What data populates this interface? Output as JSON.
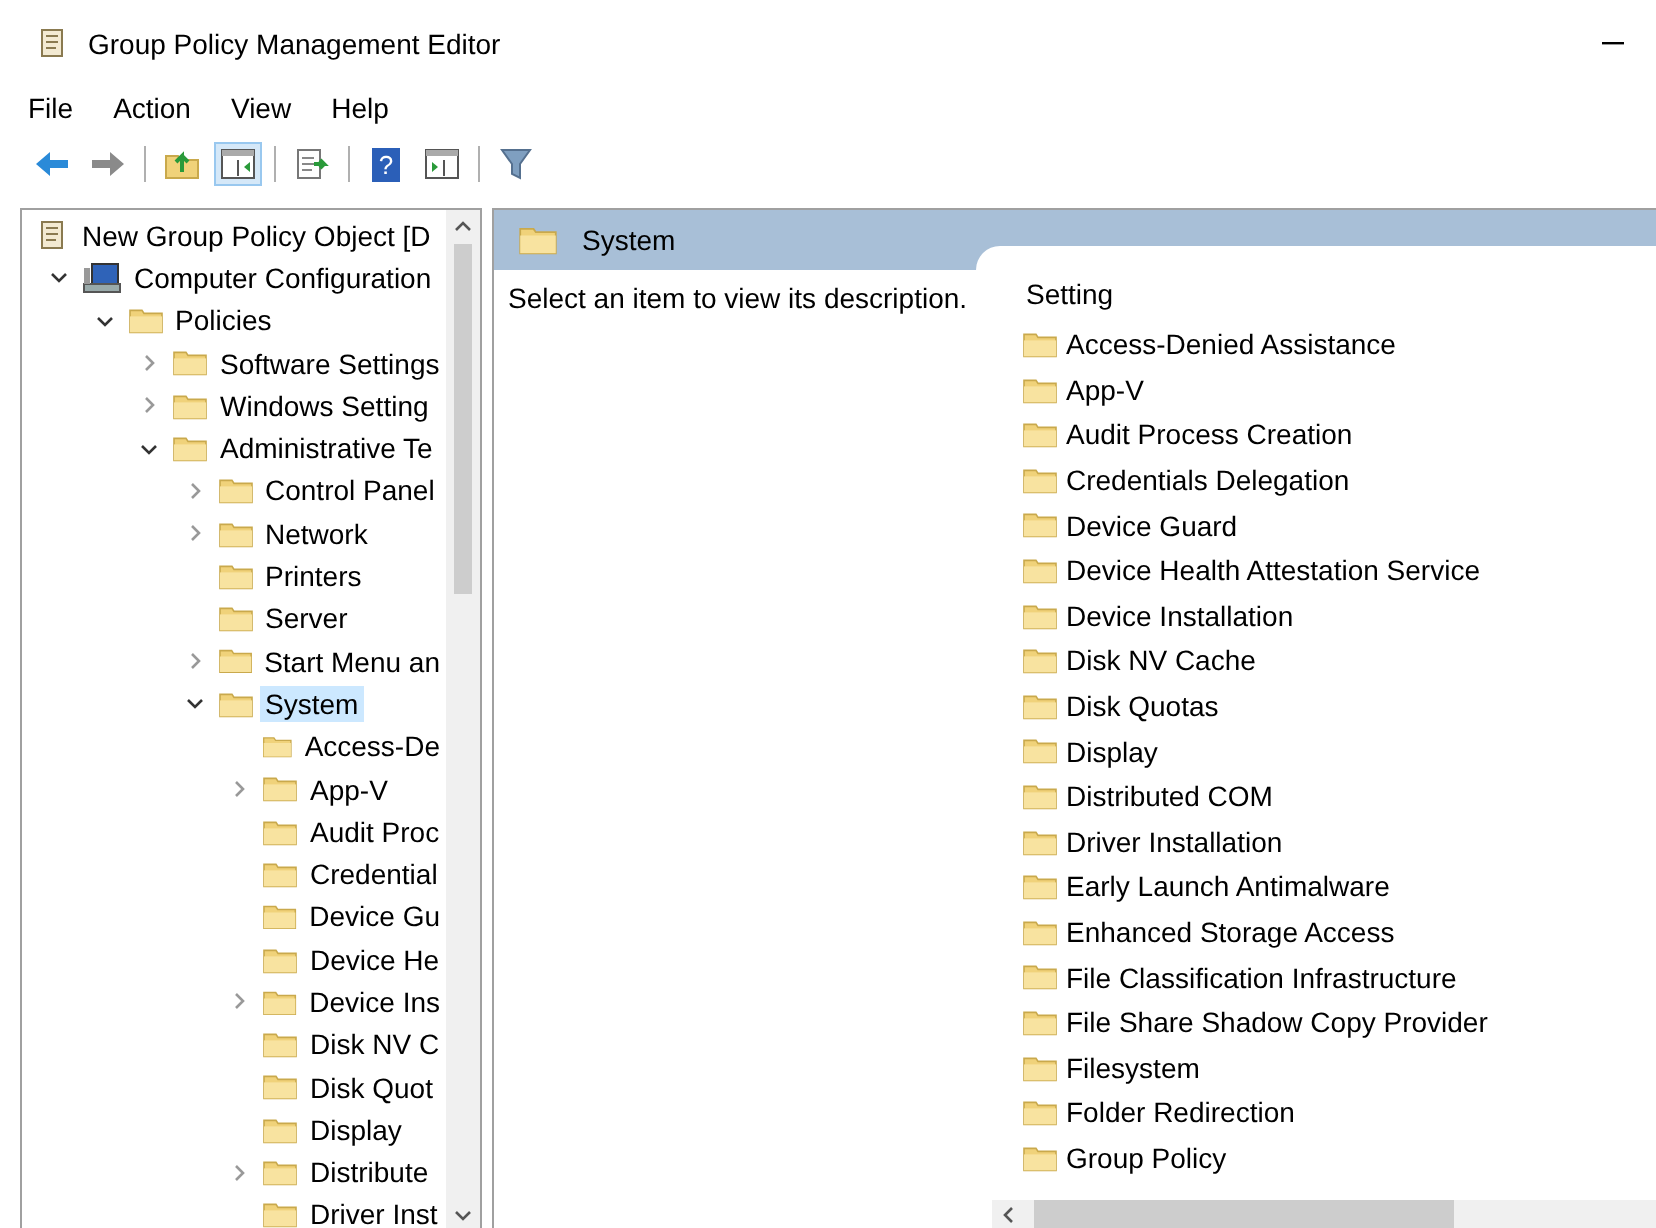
{
  "window": {
    "title": "Group Policy Management Editor"
  },
  "menu": [
    "File",
    "Action",
    "View",
    "Help"
  ],
  "toolbar": [
    [
      {
        "kind": "back",
        "pressed": false
      },
      {
        "kind": "forward",
        "pressed": false
      }
    ],
    [
      {
        "kind": "up",
        "pressed": false
      },
      {
        "kind": "tree",
        "pressed": true
      }
    ],
    [
      {
        "kind": "export",
        "pressed": false
      }
    ],
    [
      {
        "kind": "help",
        "pressed": false,
        "glyph": "?"
      },
      {
        "kind": "actions",
        "pressed": false
      }
    ],
    [
      {
        "kind": "filter",
        "pressed": false
      }
    ]
  ],
  "tree": [
    {
      "label": "New Group Policy Object [D",
      "kind": "scroll",
      "selected": false,
      "children": [
        {
          "label": "Computer Configuration",
          "kind": "computer",
          "expanded": true,
          "selected": false,
          "children": [
            {
              "label": "Policies",
              "kind": "folder",
              "expanded": true,
              "selected": false,
              "children": [
                {
                  "label": "Software Settings",
                  "kind": "folder",
                  "expanded": false,
                  "selected": false
                },
                {
                  "label": "Windows Setting",
                  "kind": "folder",
                  "expanded": false,
                  "selected": false
                },
                {
                  "label": "Administrative Te",
                  "kind": "folder",
                  "expanded": true,
                  "selected": false,
                  "children": [
                    {
                      "label": "Control Panel",
                      "kind": "folder",
                      "expanded": false,
                      "selected": false
                    },
                    {
                      "label": "Network",
                      "kind": "folder",
                      "expanded": false,
                      "selected": false
                    },
                    {
                      "label": "Printers",
                      "kind": "folder",
                      "selected": false
                    },
                    {
                      "label": "Server",
                      "kind": "folder",
                      "selected": false
                    },
                    {
                      "label": "Start Menu an",
                      "kind": "folder",
                      "expanded": false,
                      "selected": false
                    },
                    {
                      "label": "System",
                      "kind": "folder",
                      "expanded": true,
                      "selected": true,
                      "children": [
                        {
                          "label": "Access-De",
                          "kind": "folder",
                          "selected": false
                        },
                        {
                          "label": "App-V",
                          "kind": "folder",
                          "expanded": false,
                          "selected": false
                        },
                        {
                          "label": "Audit Proc",
                          "kind": "folder",
                          "selected": false
                        },
                        {
                          "label": "Credential",
                          "kind": "folder",
                          "selected": false
                        },
                        {
                          "label": "Device Gu",
                          "kind": "folder",
                          "selected": false
                        },
                        {
                          "label": "Device He",
                          "kind": "folder",
                          "selected": false
                        },
                        {
                          "label": "Device Ins",
                          "kind": "folder",
                          "expanded": false,
                          "selected": false
                        },
                        {
                          "label": "Disk NV C",
                          "kind": "folder",
                          "selected": false
                        },
                        {
                          "label": "Disk Quot",
                          "kind": "folder",
                          "selected": false
                        },
                        {
                          "label": "Display",
                          "kind": "folder",
                          "selected": false
                        },
                        {
                          "label": "Distribute",
                          "kind": "folder",
                          "expanded": false,
                          "selected": false
                        },
                        {
                          "label": "Driver Inst",
                          "kind": "folder",
                          "selected": false
                        }
                      ]
                    }
                  ]
                }
              ]
            }
          ]
        }
      ]
    }
  ],
  "details": {
    "heading": "System",
    "description": "Select an item to view its description.",
    "column": "Setting",
    "settings": [
      "Access-Denied Assistance",
      "App-V",
      "Audit Process Creation",
      "Credentials Delegation",
      "Device Guard",
      "Device Health Attestation Service",
      "Device Installation",
      "Disk NV Cache",
      "Disk Quotas",
      "Display",
      "Distributed COM",
      "Driver Installation",
      "Early Launch Antimalware",
      "Enhanced Storage Access",
      "File Classification Infrastructure",
      "File Share Shadow Copy Provider",
      "Filesystem",
      "Folder Redirection",
      "Group Policy"
    ]
  }
}
